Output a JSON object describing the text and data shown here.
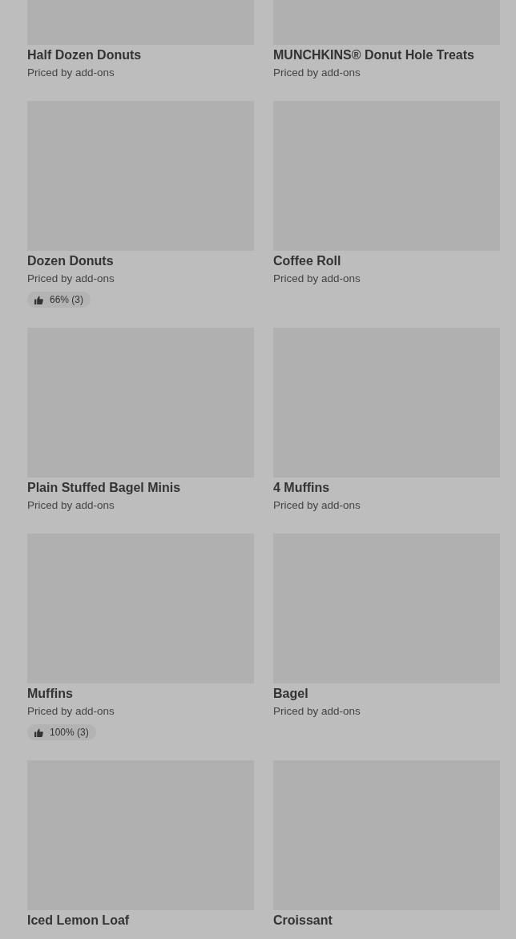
{
  "products": [
    {
      "name": "Half Dozen Donuts",
      "price_note": "Priced by add-ons"
    },
    {
      "name": "MUNCHKINS® Donut Hole Treats",
      "price_note": "Priced by add-ons"
    },
    {
      "name": "Dozen Donuts",
      "price_note": "Priced by add-ons",
      "rating": "66% (3)"
    },
    {
      "name": "Coffee Roll",
      "price_note": "Priced by add-ons"
    },
    {
      "name": "Plain Stuffed Bagel Minis",
      "price_note": "Priced by add-ons"
    },
    {
      "name": "4 Muffins",
      "price_note": "Priced by add-ons"
    },
    {
      "name": "Muffins",
      "price_note": "Priced by add-ons",
      "rating": "100% (3)"
    },
    {
      "name": "Bagel",
      "price_note": "Priced by add-ons"
    },
    {
      "name": "Iced Lemon Loaf"
    },
    {
      "name": "Croissant"
    }
  ]
}
